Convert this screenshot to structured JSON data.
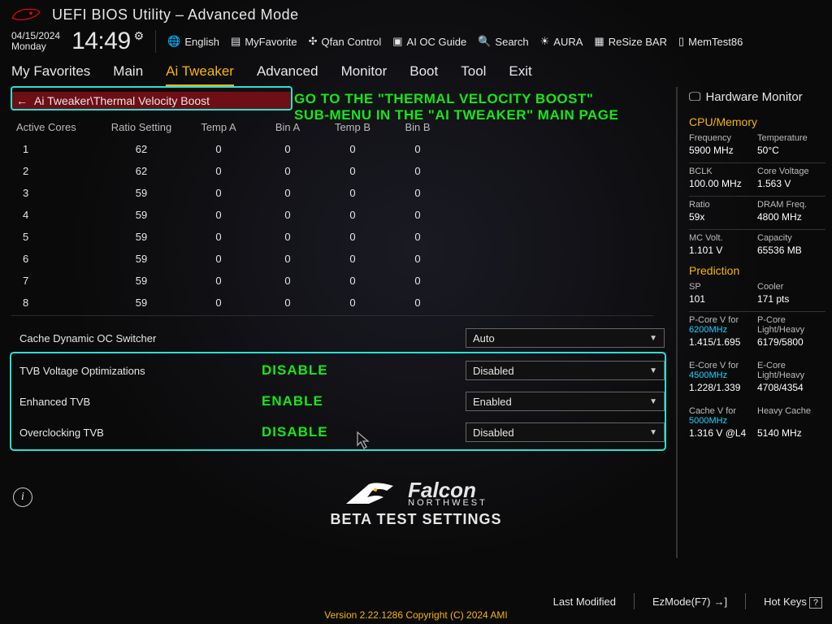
{
  "header": {
    "title": "UEFI BIOS Utility – Advanced Mode",
    "date": "04/15/2024",
    "day": "Monday",
    "time": "14:49",
    "tools": {
      "language": "English",
      "favorite": "MyFavorite",
      "qfan": "Qfan Control",
      "aioc": "AI OC Guide",
      "search": "Search",
      "aura": "AURA",
      "resize": "ReSize BAR",
      "memtest": "MemTest86"
    }
  },
  "tabs": [
    "My Favorites",
    "Main",
    "Ai Tweaker",
    "Advanced",
    "Monitor",
    "Boot",
    "Tool",
    "Exit"
  ],
  "active_tab": "Ai Tweaker",
  "breadcrumb": "Ai Tweaker\\Thermal Velocity Boost",
  "overlay": {
    "line1": "GO TO THE \"THERMAL VELOCITY BOOST\"",
    "line2": "SUB-MENU IN THE \"AI TWEAKER\" MAIN PAGE"
  },
  "table": {
    "headers": [
      "Active Cores",
      "Ratio Setting",
      "Temp A",
      "Bin A",
      "Temp B",
      "Bin B"
    ],
    "rows": [
      [
        "1",
        "62",
        "0",
        "0",
        "0",
        "0"
      ],
      [
        "2",
        "62",
        "0",
        "0",
        "0",
        "0"
      ],
      [
        "3",
        "59",
        "0",
        "0",
        "0",
        "0"
      ],
      [
        "4",
        "59",
        "0",
        "0",
        "0",
        "0"
      ],
      [
        "5",
        "59",
        "0",
        "0",
        "0",
        "0"
      ],
      [
        "6",
        "59",
        "0",
        "0",
        "0",
        "0"
      ],
      [
        "7",
        "59",
        "0",
        "0",
        "0",
        "0"
      ],
      [
        "8",
        "59",
        "0",
        "0",
        "0",
        "0"
      ]
    ]
  },
  "options": {
    "cache_oc": {
      "label": "Cache Dynamic OC Switcher",
      "value": "Auto"
    },
    "tvb_volt": {
      "label": "TVB Voltage Optimizations",
      "overlay": "DISABLE",
      "value": "Disabled"
    },
    "enh_tvb": {
      "label": "Enhanced TVB",
      "overlay": "ENABLE",
      "value": "Enabled"
    },
    "oc_tvb": {
      "label": "Overclocking TVB",
      "overlay": "DISABLE",
      "value": "Disabled"
    }
  },
  "hw": {
    "title": "Hardware Monitor",
    "cpu_mem_title": "CPU/Memory",
    "pairs": [
      {
        "a_lbl": "Frequency",
        "a_val": "5900 MHz",
        "b_lbl": "Temperature",
        "b_val": "50°C"
      },
      {
        "a_lbl": "BCLK",
        "a_val": "100.00 MHz",
        "b_lbl": "Core Voltage",
        "b_val": "1.563 V"
      },
      {
        "a_lbl": "Ratio",
        "a_val": "59x",
        "b_lbl": "DRAM Freq.",
        "b_val": "4800 MHz"
      },
      {
        "a_lbl": "MC Volt.",
        "a_val": "1.101 V",
        "b_lbl": "Capacity",
        "b_val": "65536 MB"
      }
    ],
    "pred_title": "Prediction",
    "pred": {
      "sp_lbl": "SP",
      "sp_val": "101",
      "cooler_lbl": "Cooler",
      "cooler_val": "171 pts",
      "pc_v_lbl": "P-Core V for",
      "pc_v_freq": "6200MHz",
      "pc_lh_lbl": "P-Core Light/Heavy",
      "pc_v_val": "1.415/1.695",
      "pc_lh_val": "6179/5800",
      "ec_v_lbl": "E-Core V for",
      "ec_v_freq": "4500MHz",
      "ec_lh_lbl": "E-Core Light/Heavy",
      "ec_v_val": "1.228/1.339",
      "ec_lh_val": "4708/4354",
      "cache_v_lbl": "Cache V for",
      "cache_v_freq": "5000MHz",
      "hcache_lbl": "Heavy Cache",
      "cache_v_val": "1.316 V @L4",
      "hcache_val": "5140 MHz"
    }
  },
  "footer": {
    "brand1": "Falcon",
    "brand2": "NORTHWEST",
    "beta": "BETA TEST SETTINGS",
    "last_mod": "Last Modified",
    "ezmode": "EzMode(F7)",
    "hotkeys": "Hot Keys",
    "copyright": "Version 2.22.1286 Copyright (C) 2024 AMI"
  }
}
